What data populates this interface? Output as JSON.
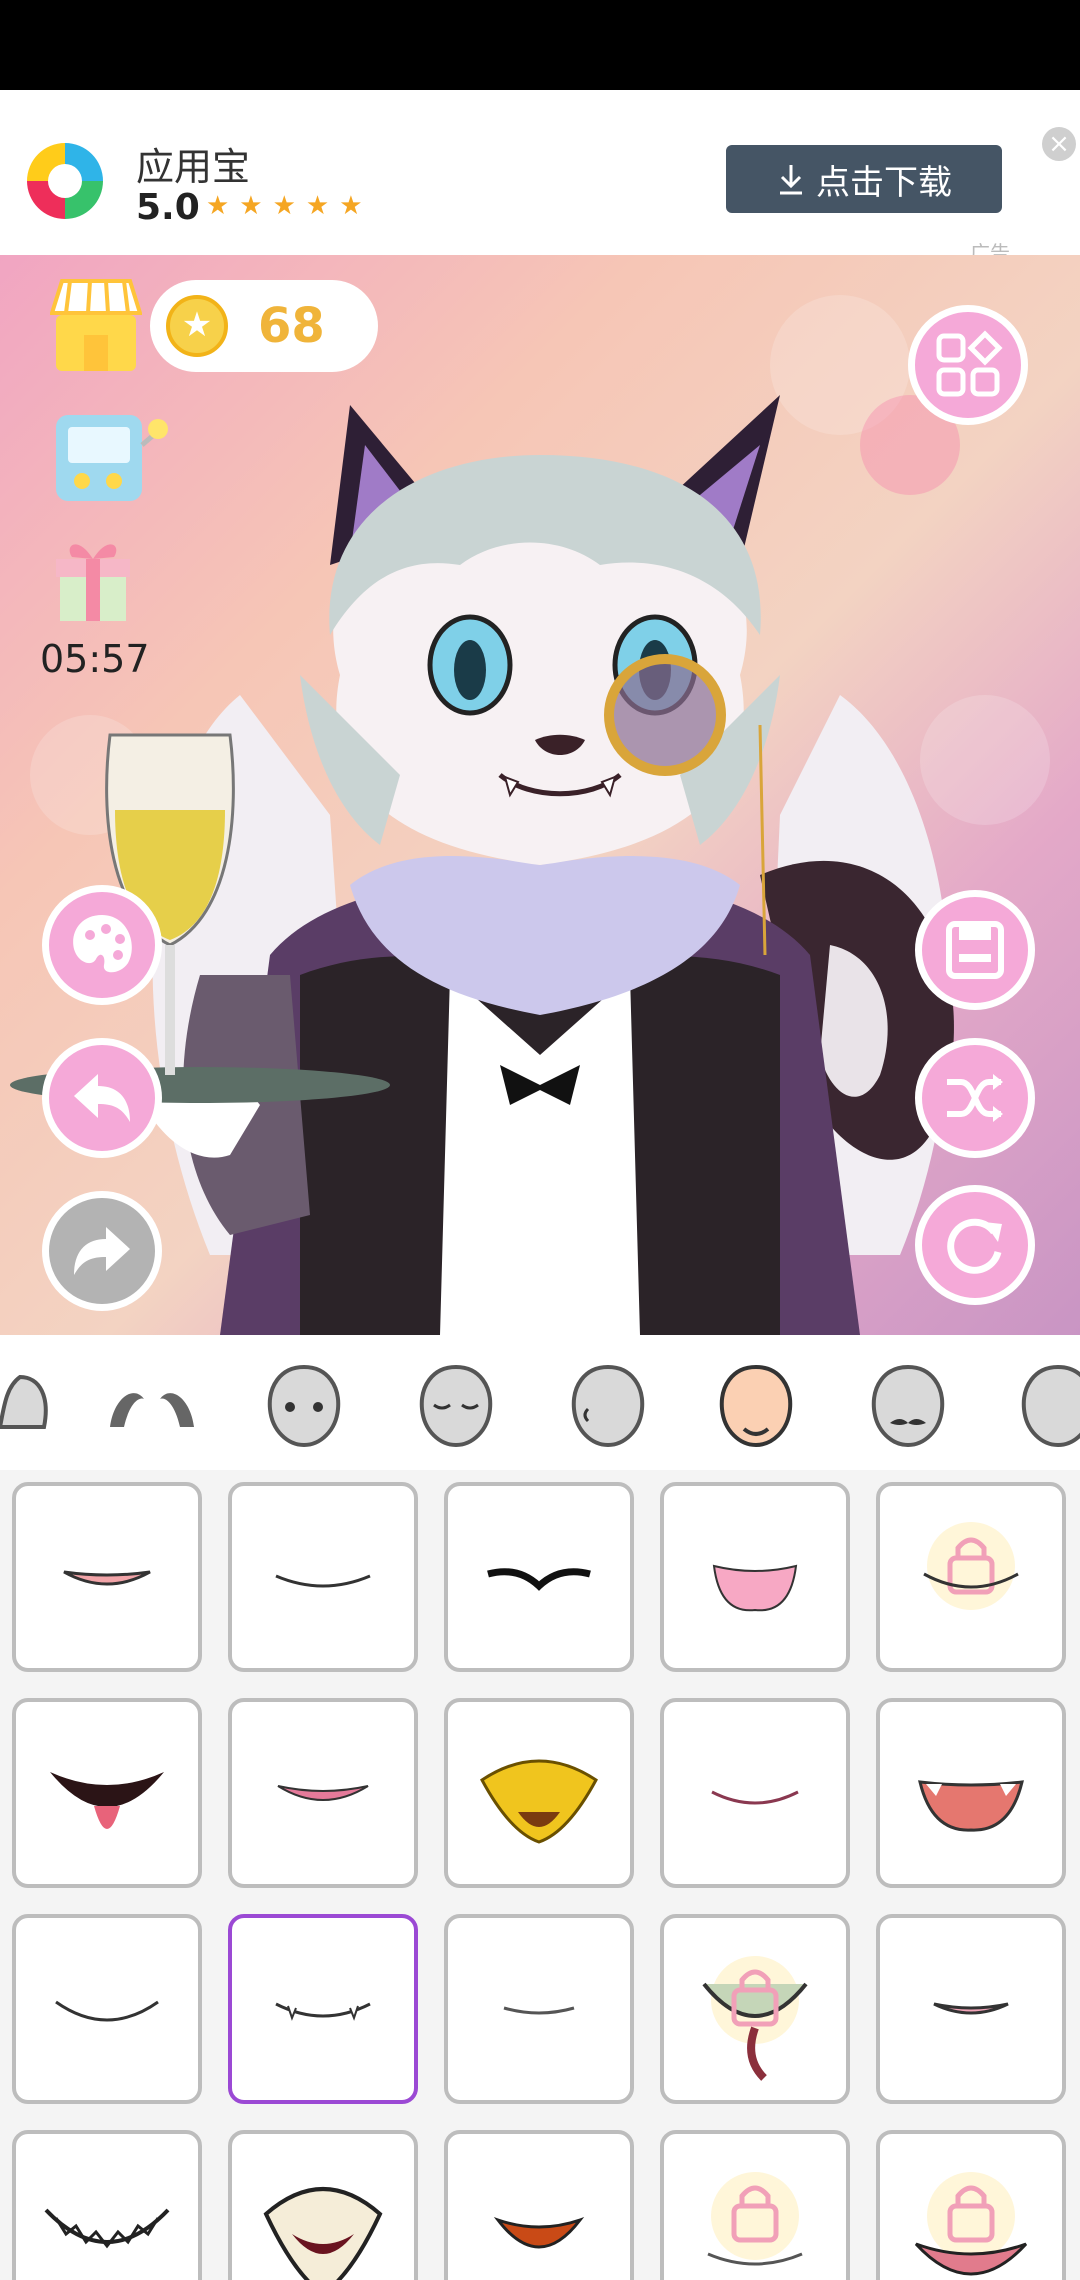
{
  "ad": {
    "app_name": "应用宝",
    "rating": "5.0",
    "stars": "★★★★★",
    "download_label": "点击下载",
    "tag": "广告"
  },
  "hud": {
    "coins": "68",
    "timer": "05:57"
  },
  "icons": {
    "shop": "shop-icon",
    "game": "game-machine-icon",
    "gift": "gift-icon",
    "menu": "grid-menu-icon",
    "palette": "palette-icon",
    "undo": "undo-icon",
    "redo": "redo-icon",
    "save": "save-icon",
    "shuffle": "shuffle-icon",
    "reset": "reset-icon"
  },
  "tabs": [
    "ears",
    "eyebrows",
    "face",
    "face-closed-eyes",
    "face-side",
    "face-skin",
    "face-mustache",
    "face-more"
  ],
  "grid": {
    "selected_index": 11,
    "locked_indices": [
      4,
      13,
      18,
      19
    ]
  }
}
